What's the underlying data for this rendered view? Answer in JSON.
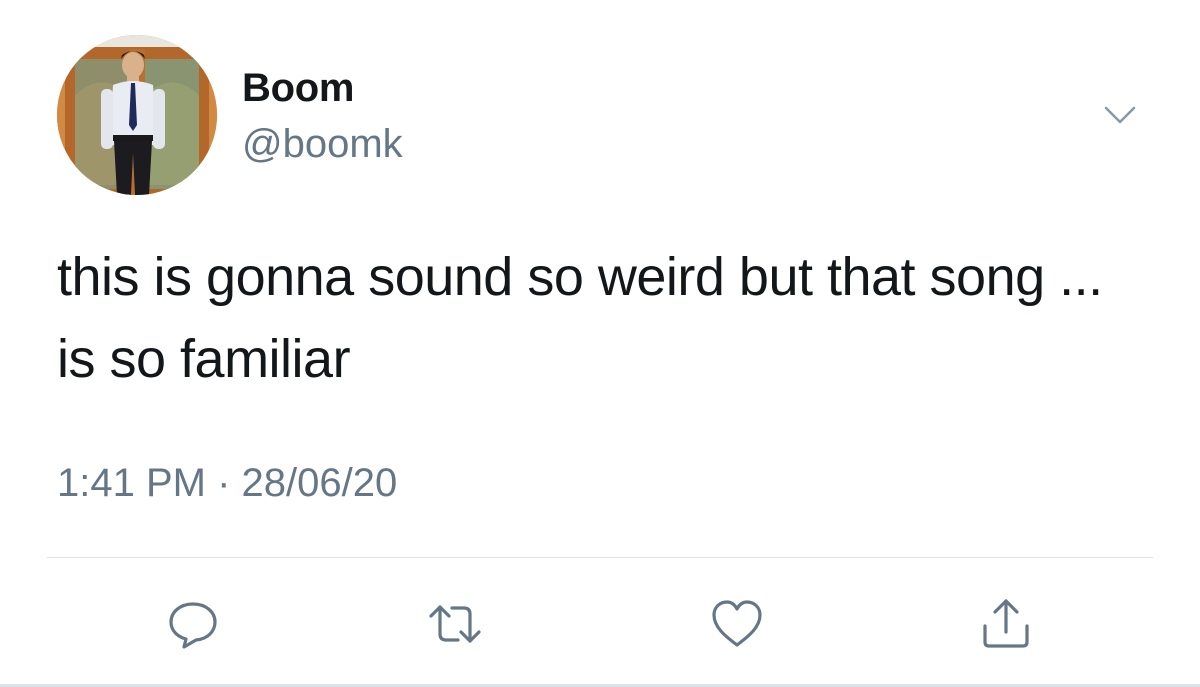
{
  "tweet": {
    "display_name": "Boom",
    "handle": "@boomk",
    "text": "this is gonna sound so weird but that song ... is so familiar",
    "time": "1:41 PM",
    "separator": "·",
    "date": "28/06/20"
  },
  "icons": {
    "menu": "chevron-down-icon",
    "reply": "reply-icon",
    "retweet": "retweet-icon",
    "like": "heart-icon",
    "share": "share-icon"
  },
  "colors": {
    "primary_text": "#14171a",
    "secondary_text": "#657786",
    "icon": "#657786",
    "divider": "#dfe3e6"
  }
}
